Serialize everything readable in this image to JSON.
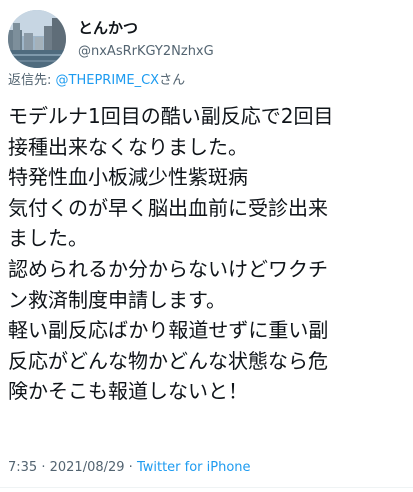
{
  "user": {
    "display_name": "とんかつ",
    "handle": "@nxAsRrKGY2NzhxG"
  },
  "reply": {
    "prefix": "返信先: ",
    "target": "@THEPRIME_CX",
    "suffix": "さん"
  },
  "tweet": {
    "lines": [
      "モデルナ1回目の酷い副反応で2回目",
      "接種出来なくなりました。",
      "特発性血小板減少性紫斑病",
      "気付くのが早く脳出血前に受診出来",
      "ました。",
      "認められるか分からないけどワクチ",
      "ン救済制度申請します。",
      "軽い副反応ばかり報道せずに重い副",
      "反応がどんな物かどんな状態なら危",
      "険かそこも報道しないと！"
    ]
  },
  "meta": {
    "time": "7:35",
    "separator": " · ",
    "date": "2021/08/29",
    "source": "Twitter for iPhone"
  }
}
